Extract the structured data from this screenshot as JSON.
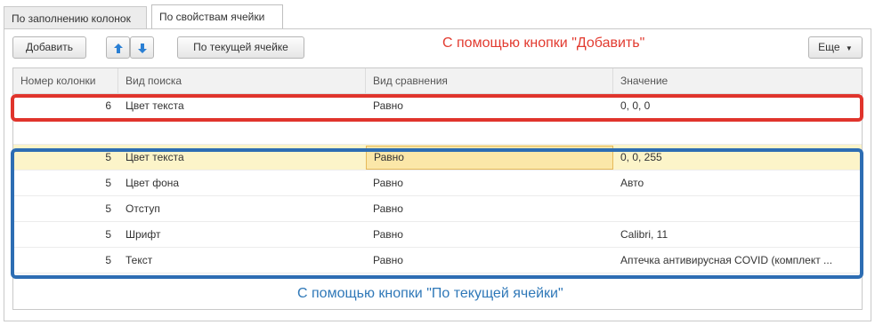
{
  "tabs": [
    {
      "label": "По заполнению колонок"
    },
    {
      "label": "По свойствам ячейки",
      "active": true
    }
  ],
  "toolbar": {
    "add_label": "Добавить",
    "up_icon": "arrow-up-icon",
    "down_icon": "arrow-down-icon",
    "current_cell_label": "По текущей ячейке",
    "more_label": "Еще"
  },
  "annotations": {
    "red_note": "С помощью кнопки \"Добавить\"",
    "blue_note": "С помощью кнопки \"По текущей ячейки\"",
    "red_color": "#e0342c",
    "blue_color": "#2d6db3"
  },
  "table": {
    "columns": [
      "Номер колонки",
      "Вид поиска",
      "Вид сравнения",
      "Значение"
    ],
    "rows": [
      {
        "num": "6",
        "search": "Цвет текста",
        "compare": "Равно",
        "value": "0, 0, 0"
      },
      {
        "num": "",
        "search": "",
        "compare": "",
        "value": ""
      },
      {
        "num": "5",
        "search": "Цвет текста",
        "compare": "Равно",
        "value": "0, 0, 255",
        "selected": true
      },
      {
        "num": "5",
        "search": "Цвет фона",
        "compare": "Равно",
        "value": "Авто"
      },
      {
        "num": "5",
        "search": "Отступ",
        "compare": "Равно",
        "value": ""
      },
      {
        "num": "5",
        "search": "Шрифт",
        "compare": "Равно",
        "value": "Calibri, 11"
      },
      {
        "num": "5",
        "search": "Текст",
        "compare": "Равно",
        "value": "Аптечка антивирусная COVID (комплект ..."
      }
    ]
  }
}
